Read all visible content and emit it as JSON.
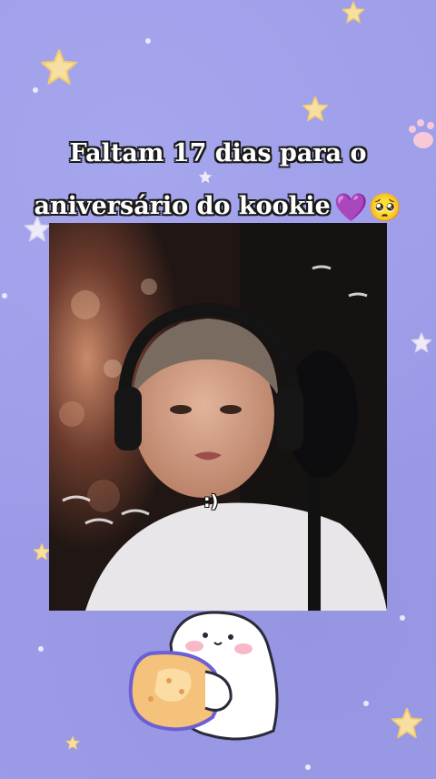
{
  "caption": {
    "line1": "Faltam 17 dias para o",
    "line2": "aniversário do kookie",
    "emojis": "💜🥺"
  },
  "photo": {
    "overlay_text": ":)"
  },
  "colors": {
    "background": "#9c9ce8",
    "star": "#f6dfa0",
    "caption_text": "#ffffff",
    "caption_outline": "#1a1a1a"
  },
  "decorations": {
    "stars": "star-icon",
    "paws": "paw-icon",
    "sticker": "cookie-sticker"
  }
}
